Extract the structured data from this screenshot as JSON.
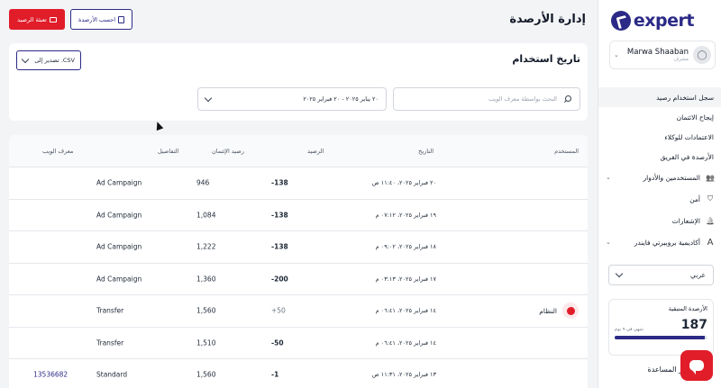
{
  "brand": {
    "logo_text": "expert"
  },
  "user": {
    "name": "Marwa Shaaban",
    "role": "مشرف"
  },
  "nav": {
    "items": [
      {
        "label": "سجل استخدام رصيد",
        "active": true,
        "type": "sub"
      },
      {
        "label": "إيجاح الائتمان",
        "type": "sub"
      },
      {
        "label": "الاعتمادات للوكلاء",
        "type": "sub"
      },
      {
        "label": "الأرصدة في الفريق",
        "type": "sub"
      },
      {
        "label": "المستخدمين والأدوار",
        "type": "top",
        "icon": "users-icon",
        "chevron": true
      },
      {
        "label": "أمن",
        "type": "top",
        "icon": "shield-icon"
      },
      {
        "label": "الإشعارات",
        "type": "top",
        "icon": "bell-icon"
      },
      {
        "label": "أكاديمية بروبيرتي فايندر",
        "type": "top",
        "icon": "academy-icon",
        "chevron": true
      }
    ]
  },
  "language": {
    "selected": "عربي"
  },
  "credits": {
    "title": "الأرصدة المتبقية",
    "remaining": "187",
    "expires": "تنتهي في ٩ يوم",
    "progress_fraction": 0.97
  },
  "help": {
    "label": "مركز المساعدة"
  },
  "header": {
    "title": "إدارة الأرصدة",
    "top_up_label": "تعبئة الرصيد",
    "calculate_label": "احسب الأرصدة"
  },
  "filters": {
    "title": "تاريخ استخدام",
    "export_label": "تصدير إلى .CSV",
    "search_placeholder": "البحث بواسطة معرف الويب",
    "date_range": "٢٠ يناير ٢٠٢٥ - ٢٠ فبراير ٢٠٢٥"
  },
  "table": {
    "columns": {
      "user": "المستخدم",
      "date": "التاريخ",
      "balance": "الرصيد",
      "credit_balance": "رصيد الإئتمان",
      "details": "التفاصيل",
      "web_id": "معرف الويب"
    },
    "rows": [
      {
        "user": "",
        "date": "٢٠ فبراير ٢٠٢٥، ١١:٤٠ ص",
        "balance": "-138",
        "credit_balance": "946",
        "details": "Ad Campaign",
        "web_id": ""
      },
      {
        "user": "",
        "date": "١٩ فبراير ٢٠٢٥، ٠٧:١٢ م",
        "balance": "-138",
        "credit_balance": "1,084",
        "details": "Ad Campaign",
        "web_id": ""
      },
      {
        "user": "",
        "date": "١٨ فبراير ٢٠٢٥، ٠٩:٠٢ م",
        "balance": "-138",
        "credit_balance": "1,222",
        "details": "Ad Campaign",
        "web_id": ""
      },
      {
        "user": "",
        "date": "١٧ فبراير ٢٠٢٥، ٠٣:١٣ م",
        "balance": "-200",
        "credit_balance": "1,360",
        "details": "Ad Campaign",
        "web_id": ""
      },
      {
        "user": "النظام",
        "date": "١٤ فبراير ٢٠٢٥، ٠٦:٤١ م",
        "balance": "+50",
        "credit_balance": "1,560",
        "details": "Transfer",
        "web_id": "",
        "system": true
      },
      {
        "user": "",
        "date": "١٤ فبراير ٢٠٢٥، ٠٦:٤١ م",
        "balance": "-50",
        "credit_balance": "1,510",
        "details": "Transfer",
        "web_id": ""
      },
      {
        "user": "",
        "date": "١٣ فبراير ٢٠٢٥، ١١:٣١ ص",
        "balance": "-1",
        "credit_balance": "1,560",
        "details": "Standard",
        "web_id": "13536682"
      }
    ]
  },
  "colors": {
    "brand": "#2b2a86",
    "accent_red": "#e11d2a"
  }
}
